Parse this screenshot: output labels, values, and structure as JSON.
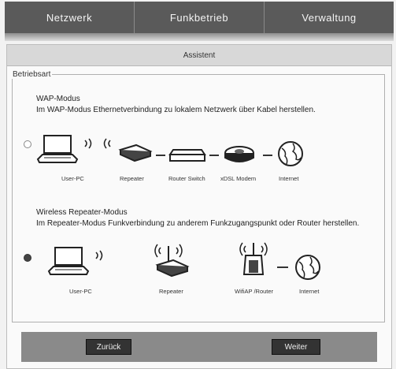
{
  "tabs": [
    "Netzwerk",
    "Funkbetrieb",
    "Verwaltung"
  ],
  "panel_title": "Assistent",
  "group_legend": "Betriebsart",
  "wap": {
    "title": "WAP-Modus",
    "desc": "Im WAP-Modus Ethernetverbindung zu lokalem Netzwerk über Kabel herstellen.",
    "selected": false,
    "labels": [
      "User-PC",
      "Repeater",
      "Router Switch",
      "xDSL Modem",
      "Internet"
    ]
  },
  "repeater": {
    "title": "Wireless Repeater-Modus",
    "desc": "Im Repeater-Modus Funkverbindung zu anderem Funkzugangspunkt oder Router herstellen.",
    "selected": true,
    "labels": [
      "User-PC",
      "Repeater",
      "WifiAP /Router",
      "Internet"
    ]
  },
  "buttons": {
    "back": "Zurück",
    "next": "Weiter"
  },
  "icons": [
    "laptop-icon",
    "wifi-waves-icon",
    "repeater-icon",
    "switch-icon",
    "modem-icon",
    "globe-icon",
    "wifi-router-icon"
  ]
}
